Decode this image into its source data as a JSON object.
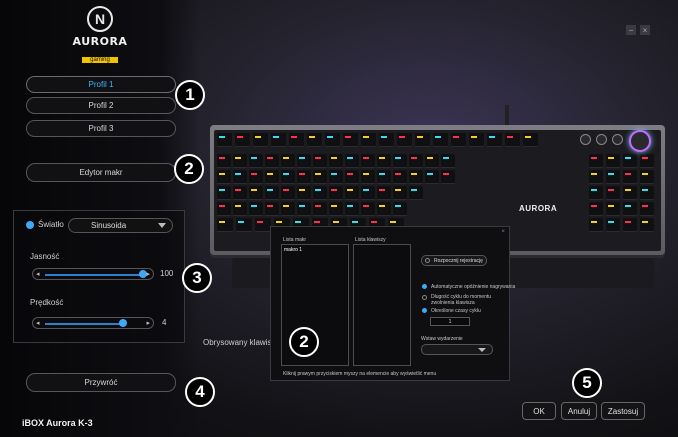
{
  "logo": {
    "mark": "N",
    "name": "AURORA",
    "sub": "gaming"
  },
  "profiles": [
    "Profil 1",
    "Profil 2",
    "Profil 3"
  ],
  "active_profile": 0,
  "macro_editor_label": "Edytor makr",
  "lighting": {
    "toggle_label": "Światło",
    "mode": "Sinusoida",
    "brightness_label": "Jasność",
    "brightness_value": "100",
    "brightness_level": 1.0,
    "speed_label": "Prędkość",
    "speed_value": "4",
    "speed_level": 0.8
  },
  "reset_label": "Przywróć",
  "device_name": "iBOX Aurora K-3",
  "keyboard_brand": "AURORA",
  "callouts": [
    "1",
    "2",
    "3",
    "4",
    "2",
    "5"
  ],
  "outline_text": "Obrysowany klawisz n",
  "dialog": {
    "col1_title": "Lista makr",
    "col2_title": "Lista klawiszy",
    "macro_item": "makro 1",
    "record_button": "Rozpocznij rejestrację",
    "auto_delay": "Automatyczne opóźnienie nagrywania",
    "cycle_until_release": "Długość cyklu do momentu zwolnienia klawisza",
    "fixed_cycles": "Określone czasy cyklu",
    "cycles_value": "1",
    "insert_event_label": "Wstaw wydarzenie",
    "hint": "Kliknij prawym przyciskiem myszy na elemencie aby wyświetlić menu"
  },
  "buttons": {
    "ok": "OK",
    "cancel": "Anuluj",
    "apply": "Zastosuj"
  },
  "window_controls": {
    "minimize": "−",
    "close": "×"
  },
  "colors": {
    "accent_blue": "#3fa9f5",
    "logo_yellow": "#f2c300",
    "key_cyan": "#33e0f0",
    "key_red": "#ff3050",
    "key_yellow": "#f5d020"
  }
}
